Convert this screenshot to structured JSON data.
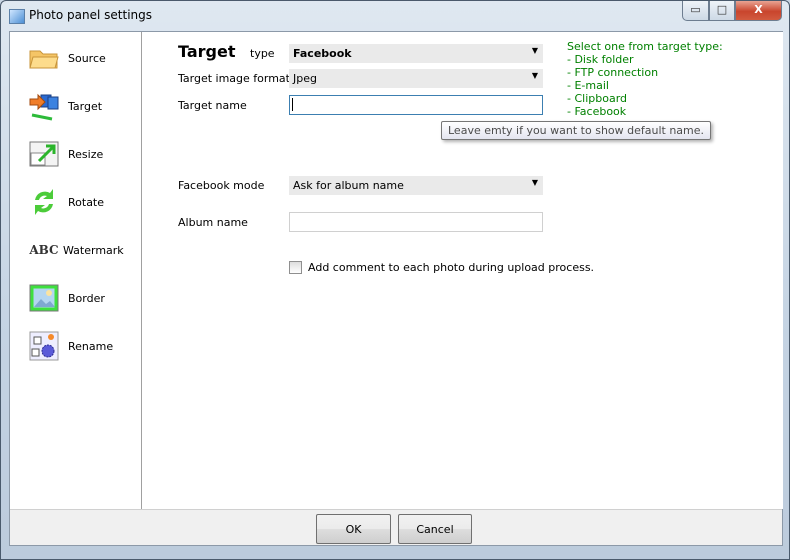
{
  "window": {
    "title": "Photo panel settings",
    "minimize": "▭",
    "maximize": "□",
    "close": "X"
  },
  "sidebar": {
    "items": [
      {
        "label": "Source",
        "icon": "folder-icon"
      },
      {
        "label": "Target",
        "icon": "network-target-icon"
      },
      {
        "label": "Resize",
        "icon": "resize-icon"
      },
      {
        "label": "Rotate",
        "icon": "rotate-icon"
      },
      {
        "label": "Watermark",
        "icon": "abc-text-icon",
        "icon_text": "ABC"
      },
      {
        "label": "Border",
        "icon": "picture-border-icon"
      },
      {
        "label": "Rename",
        "icon": "rename-gear-icon"
      }
    ]
  },
  "form": {
    "heading": "Target",
    "type_label": "type",
    "type_value": "Facebook",
    "format_label": "Target image format",
    "format_value": "Jpeg",
    "name_label": "Target name",
    "name_value": "",
    "name_tooltip": "Leave emty if you want to show default name.",
    "mode_label": "Facebook mode",
    "mode_value": "Ask for album name",
    "album_label": "Album name",
    "album_value": "",
    "comment_label": "Add comment to each photo during upload process.",
    "comment_checked": false
  },
  "hint": {
    "title": "Select one from target type:",
    "items": [
      "- Disk folder",
      "- FTP connection",
      "- E-mail",
      "- Clipboard",
      "- Facebook"
    ],
    "color": "#008000"
  },
  "buttons": {
    "ok": "OK",
    "cancel": "Cancel"
  }
}
